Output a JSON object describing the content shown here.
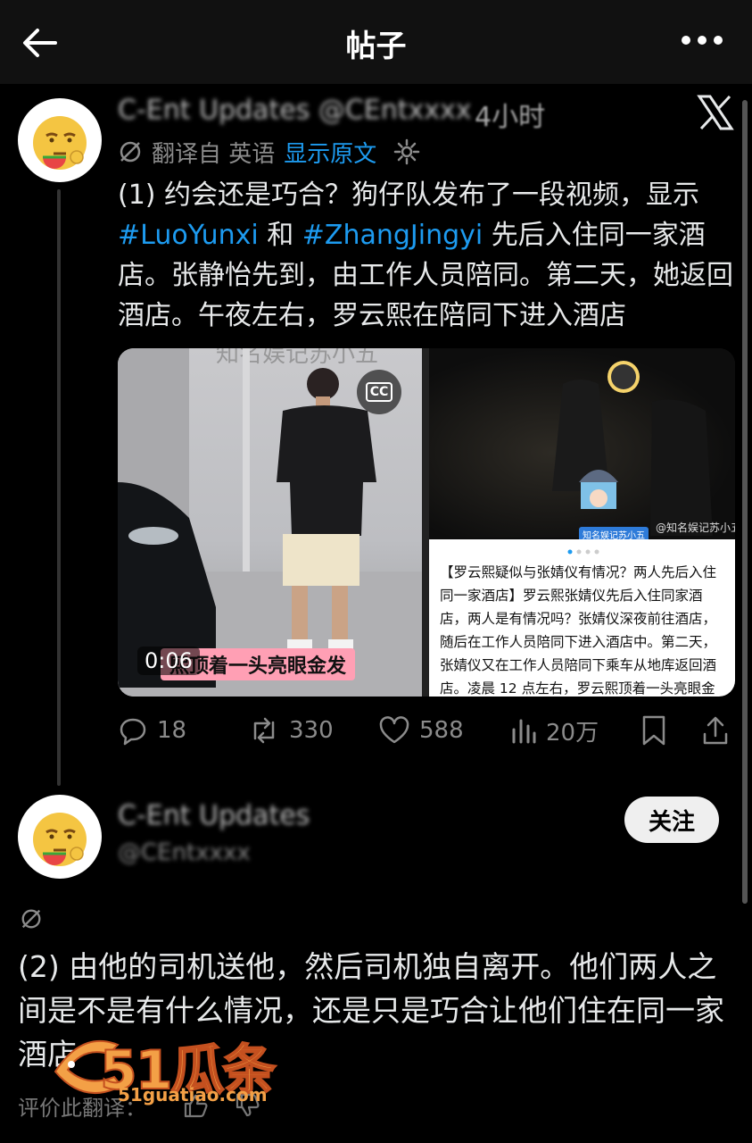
{
  "topbar": {
    "title": "帖子"
  },
  "post1": {
    "author_blurred": "C-Ent Updates @CEntxxxx",
    "time": "4小时",
    "translate": {
      "info": "翻译自 英语",
      "show_original": "显示原文"
    },
    "text": {
      "part1": "(1) 约会还是巧合？狗仔队发布了一段视频，显示",
      "tag1": "#LuoYunxi",
      "part2": " 和 ",
      "tag2": "#ZhangJingyi",
      "part3": " 先后入住同一家酒店。张静怡先到，由工作人员陪同。第二天，她返回酒店。午夜左右，罗云熙在陪同下进入酒店"
    },
    "media": {
      "left": {
        "watermark": "知名娱记苏小五",
        "cc": "CC",
        "duration": "0:06",
        "caption": "熙顶着一头亮眼金发"
      },
      "right": {
        "watermark": "@知名娱记苏小五",
        "badge": "知名娱记苏小五",
        "article": "【罗云熙疑似与张婧仪有情况？两人先后入住同一家酒店】罗云熙张婧仪先后入住同家酒店，两人是有情况吗？张婧仪深夜前往酒店，随后在工作人员陪同下进入酒店中。第二天，张婧仪又在工作人员陪同下乘车从地库返回酒店。凌晨 12 点左右，罗云熙顶着一头亮眼金发，在"
      }
    },
    "stats": {
      "replies": "18",
      "reposts": "330",
      "likes": "588",
      "views": "20万"
    }
  },
  "post2": {
    "name_blurred": "C-Ent Updates",
    "handle_blurred": "@CEntxxxx",
    "follow_label": "关注",
    "text": "(2) 由他的司机送他，然后司机独自离开。他们两人之间是不是有什么情况，还是只是巧合让他们住在同一家酒店",
    "rate": "评价此翻译："
  },
  "watermark": {
    "logo": "51瓜条",
    "url": "51guatiao.com"
  },
  "colors": {
    "accent": "#1d9bf0",
    "background": "#000000",
    "text": "#e7e9ea",
    "muted": "#8b8b8b"
  }
}
